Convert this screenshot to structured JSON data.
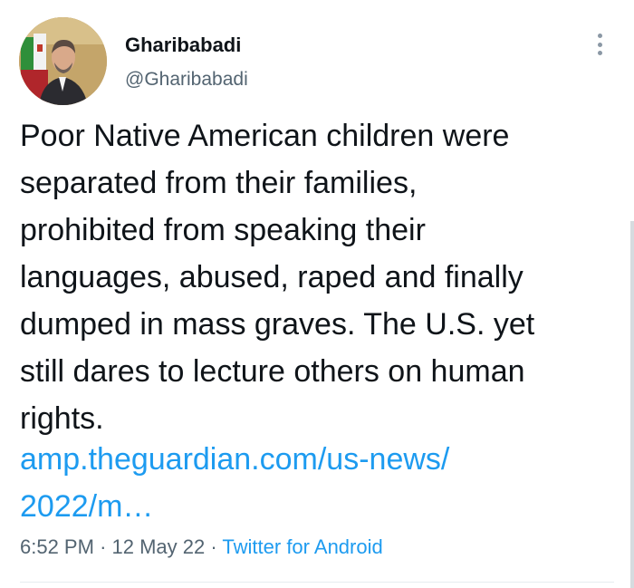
{
  "author": {
    "display_name": "Gharibabadi",
    "handle": "@Gharibabadi"
  },
  "tweet": {
    "text_lines": [
      "Poor Native American children were",
      "separated from their families,",
      "prohibited from speaking their",
      "languages, abused, raped and finally",
      "dumped in mass graves. The U.S. yet",
      "still dares to lecture others on human",
      "rights."
    ],
    "link_lines": [
      "amp.theguardian.com/us-news/",
      "2022/m…"
    ]
  },
  "meta": {
    "time": "6:52 PM",
    "separator": "·",
    "date": "12 May 22",
    "source": "Twitter for Android"
  },
  "colors": {
    "link": "#1d9bf0",
    "secondary_text": "#536471",
    "primary_text": "#0f1419"
  },
  "icons": {
    "more": "vertical-ellipsis"
  }
}
